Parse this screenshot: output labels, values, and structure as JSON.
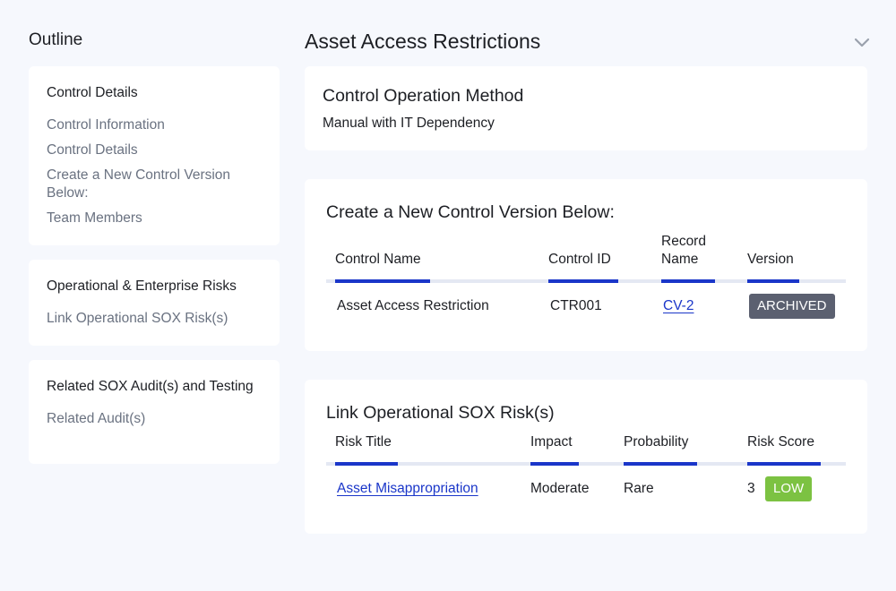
{
  "outline": {
    "title": "Outline",
    "groups": [
      {
        "heading": "Control Details",
        "links": [
          "Control Information",
          "Control Details",
          "Create a New Control Version Below:",
          "Team Members"
        ]
      },
      {
        "heading": "Operational & Enterprise Risks",
        "links": [
          "Link Operational SOX Risk(s)"
        ]
      },
      {
        "heading": "Related SOX Audit(s) and Testing",
        "links": [
          "Related Audit(s)"
        ]
      }
    ]
  },
  "page": {
    "title": "Asset Access Restrictions",
    "collapse_icon": "chevron-down-icon"
  },
  "operation": {
    "title": "Control Operation Method",
    "value": "Manual with IT Dependency"
  },
  "versions": {
    "title": "Create a New Control Version Below:",
    "columns": [
      "Control Name",
      "Control ID",
      "Record Name",
      "Version"
    ],
    "rows": [
      {
        "control_name": "Asset Access Restriction",
        "control_id": "CTR001",
        "record_name": "CV-2",
        "version": "ARCHIVED"
      }
    ]
  },
  "risks": {
    "title": "Link Operational SOX Risk(s)",
    "columns": [
      "Risk Title",
      "Impact",
      "Probability",
      "Risk Score"
    ],
    "rows": [
      {
        "risk_title": "Asset Misappropriation",
        "impact": "Moderate",
        "probability": "Rare",
        "score": "3",
        "level": "LOW"
      }
    ]
  },
  "colors": {
    "accent": "#1a36c9",
    "archived_badge": "#5b6070",
    "low_badge": "#7cc242",
    "background": "#f6f8fd"
  }
}
